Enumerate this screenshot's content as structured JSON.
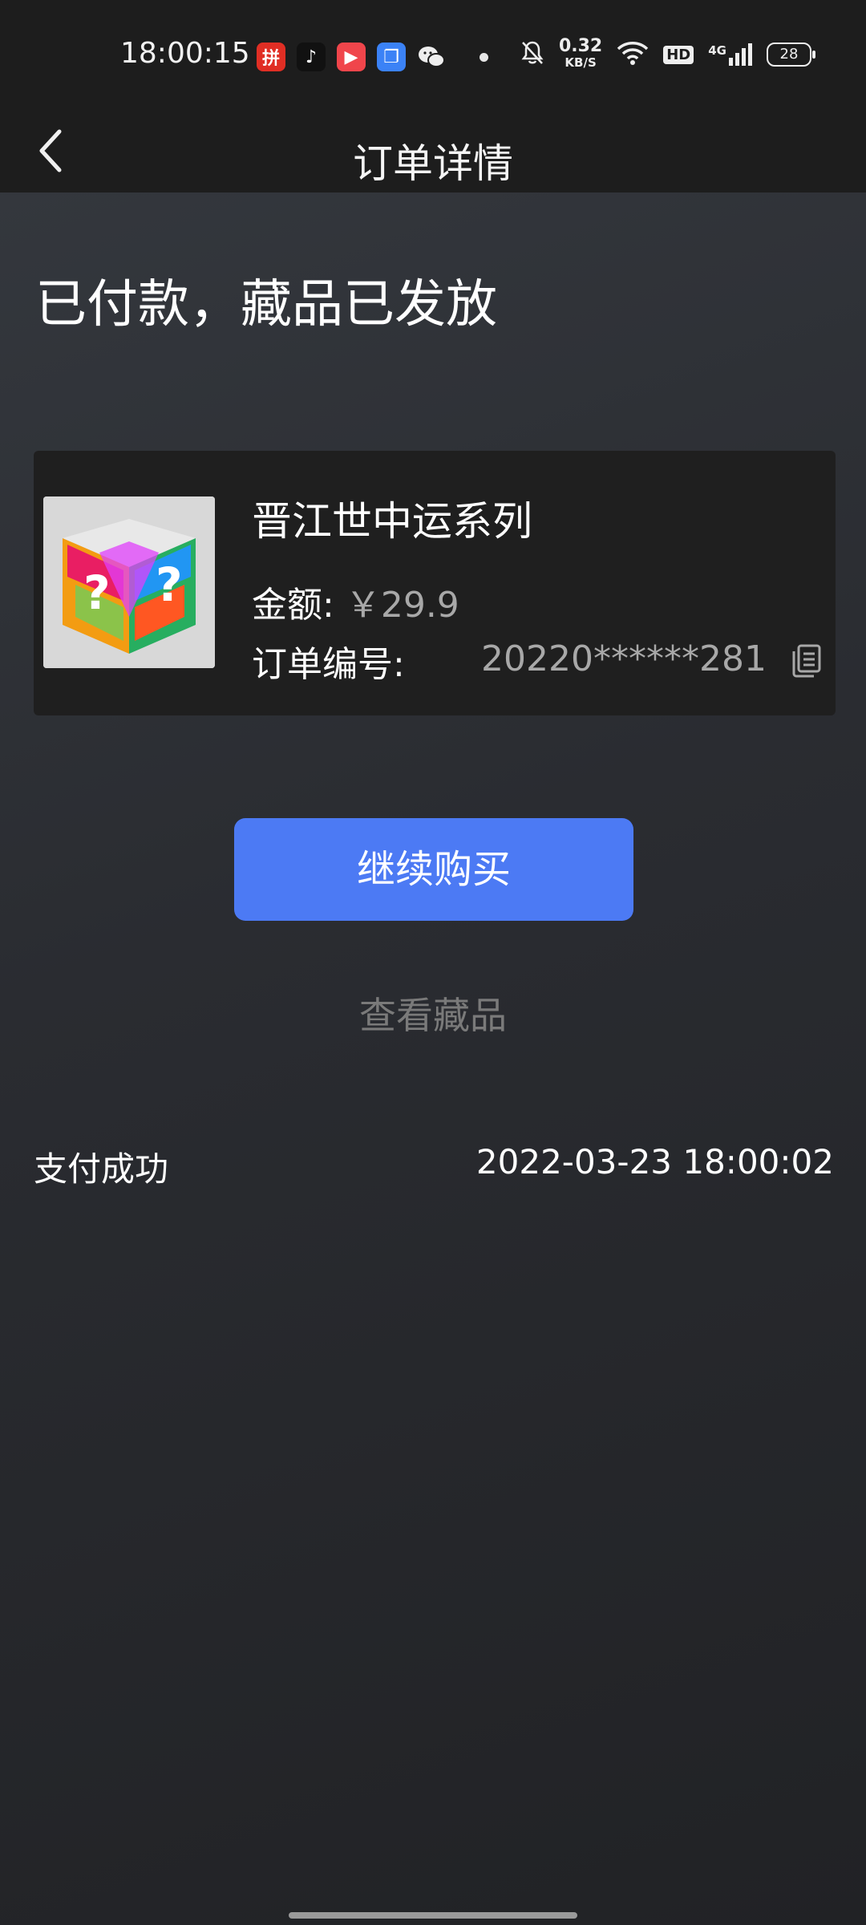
{
  "status_bar": {
    "time": "18:00:15",
    "net_speed_value": "0.32",
    "net_speed_unit": "KB/S",
    "hd_label": "HD",
    "signal_label": "4G",
    "battery": "28",
    "app_icons": [
      "pinduoduo-icon",
      "tiktok-icon",
      "video-app-icon",
      "dual-window-icon",
      "wechat-icon"
    ]
  },
  "header": {
    "title": "订单详情"
  },
  "order": {
    "status_text": "已付款，藏品已发放",
    "item_name": "晋江世中运系列",
    "amount_label": "金额:",
    "amount_value": "￥29.9",
    "order_no_label": "订单编号:",
    "order_no_value": "20220******281"
  },
  "actions": {
    "continue_buy": "继续购买",
    "view_collection": "查看藏品"
  },
  "payment": {
    "label": "支付成功",
    "time": "2022-03-23 18:00:02"
  },
  "colors": {
    "accent": "#4c7af4",
    "card_bg": "#1f1f1f",
    "bar_bg": "#1d1d1d"
  }
}
